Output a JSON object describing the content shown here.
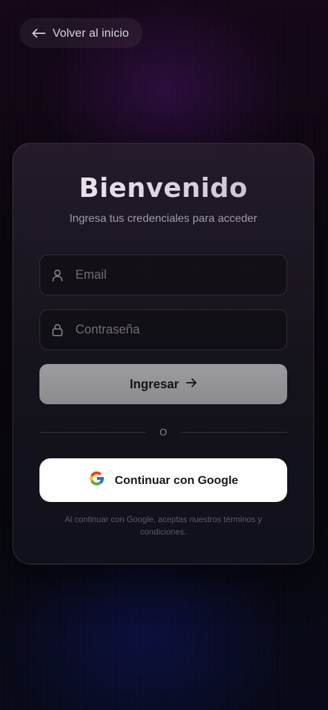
{
  "nav": {
    "back_label": "Volver al inicio",
    "back_icon": "arrow-left-icon"
  },
  "login": {
    "title": "Bienvenido",
    "subtitle": "Ingresa tus credenciales para acceder",
    "email": {
      "placeholder": "Email",
      "value": "",
      "icon": "user-icon"
    },
    "password": {
      "placeholder": "Contraseña",
      "value": "",
      "icon": "lock-icon"
    },
    "submit_label": "Ingresar",
    "submit_icon": "arrow-right-icon",
    "divider_text": "O",
    "google_label": "Continuar con Google",
    "google_icon": "google-logo-icon",
    "terms_text": "Al continuar con Google, aceptas nuestros términos y condiciones."
  },
  "colors": {
    "background": "#0c0810",
    "card": "#1c1a22",
    "submit_button": "#949397",
    "google_button": "#ffffff"
  }
}
